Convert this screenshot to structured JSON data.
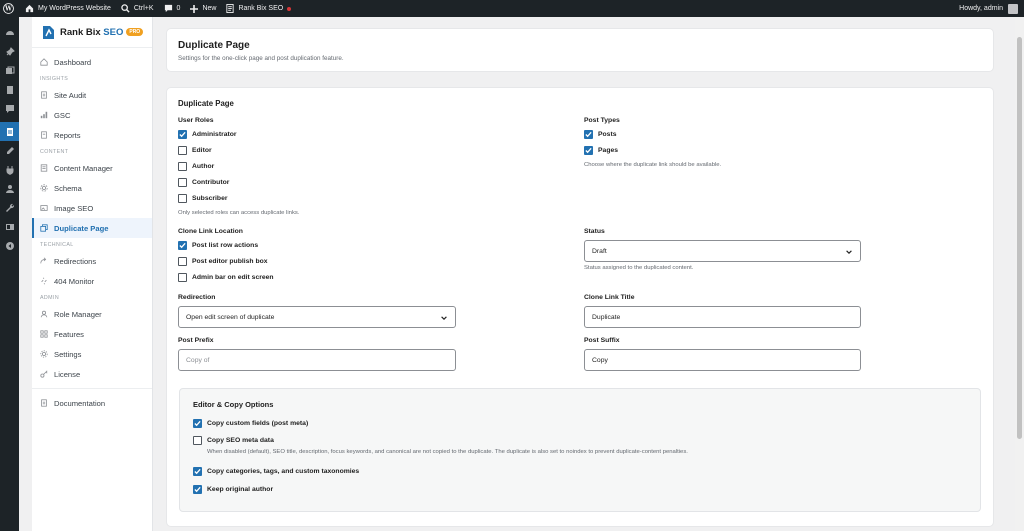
{
  "adminbar": {
    "site_name": "My WordPress Website",
    "search_shortcut": "Ctrl+K",
    "comments_count": "0",
    "new_label": "New",
    "plugin_label": "Rank Bix SEO",
    "greeting": "Howdy, admin"
  },
  "brand": {
    "name_part1": "Rank Bix",
    "name_part2": "SEO",
    "badge": "PRO"
  },
  "sidebar": {
    "dashboard": "Dashboard",
    "insights_label": "INSIGHTS",
    "site_audit": "Site Audit",
    "gsc": "GSC",
    "reports": "Reports",
    "content_label": "CONTENT",
    "content_manager": "Content Manager",
    "schema": "Schema",
    "image_seo": "Image SEO",
    "duplicate_page": "Duplicate Page",
    "technical_label": "TECHNICAL",
    "redirections": "Redirections",
    "monitor_404": "404 Monitor",
    "admin_label": "ADMIN",
    "role_manager": "Role Manager",
    "features": "Features",
    "settings": "Settings",
    "license": "License",
    "documentation": "Documentation"
  },
  "header": {
    "title": "Duplicate Page",
    "subtitle": "Settings for the one-click page and post duplication feature."
  },
  "settings": {
    "section_title": "Duplicate Page",
    "user_roles": {
      "label": "User Roles",
      "administrator": {
        "label": "Administrator",
        "checked": true
      },
      "editor": {
        "label": "Editor",
        "checked": false
      },
      "author": {
        "label": "Author",
        "checked": false
      },
      "contributor": {
        "label": "Contributor",
        "checked": false
      },
      "subscriber": {
        "label": "Subscriber",
        "checked": false
      },
      "help": "Only selected roles can access duplicate links."
    },
    "post_types": {
      "label": "Post Types",
      "posts": {
        "label": "Posts",
        "checked": true
      },
      "pages": {
        "label": "Pages",
        "checked": true
      },
      "help": "Choose where the duplicate link should be available."
    },
    "clone_location": {
      "label": "Clone Link Location",
      "post_list": {
        "label": "Post list row actions",
        "checked": true
      },
      "editor_publish": {
        "label": "Post editor publish box",
        "checked": false
      },
      "admin_bar": {
        "label": "Admin bar on edit screen",
        "checked": false
      }
    },
    "status": {
      "label": "Status",
      "value": "Draft",
      "help": "Status assigned to the duplicated content."
    },
    "redirection": {
      "label": "Redirection",
      "value": "Open edit screen of duplicate"
    },
    "clone_title": {
      "label": "Clone Link Title",
      "value": "Duplicate"
    },
    "post_prefix": {
      "label": "Post Prefix",
      "placeholder": "Copy of"
    },
    "post_suffix": {
      "label": "Post Suffix",
      "value": "Copy"
    },
    "editor_copy": {
      "title": "Editor & Copy Options",
      "custom_fields": {
        "label": "Copy custom fields (post meta)",
        "checked": true
      },
      "seo_meta": {
        "label": "Copy SEO meta data",
        "checked": false
      },
      "seo_help": "When disabled (default), SEO title, description, focus keywords, and canonical are not copied to the duplicate. The duplicate is also set to noindex to prevent duplicate-content penalties.",
      "taxonomies": {
        "label": "Copy categories, tags, and custom taxonomies",
        "checked": true
      },
      "author": {
        "label": "Keep original author",
        "checked": true
      }
    }
  },
  "colors": {
    "accent": "#2271b1",
    "adminbar": "#1d2327",
    "pro_badge": "#f0a020"
  }
}
